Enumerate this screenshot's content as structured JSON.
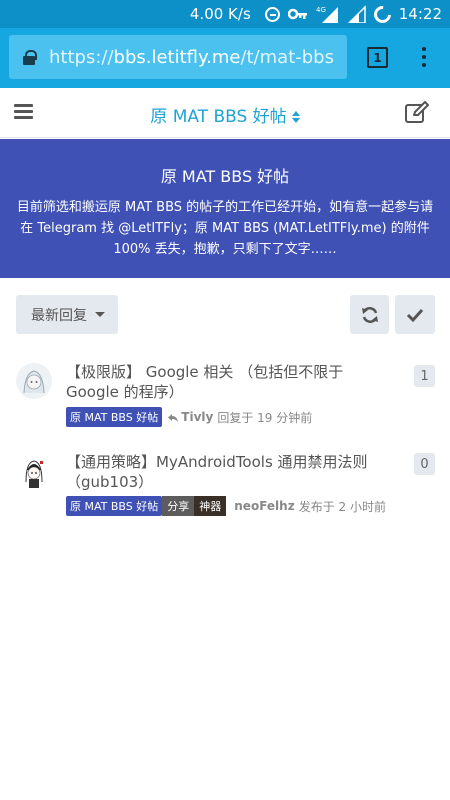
{
  "status_bar": {
    "net_speed": "4.00 K/s",
    "network_type": "4G",
    "time": "14:22",
    "icons": [
      "data-saver-icon",
      "vpn-key-icon",
      "signal-icon",
      "signal-icon",
      "sync-icon"
    ]
  },
  "browser": {
    "url_proto": "https://",
    "url_host": "bbs.letitfly.me",
    "url_path": "/t/mat-bbs",
    "tab_count": "1"
  },
  "header": {
    "title": "原 MAT BBS 好帖"
  },
  "banner": {
    "title": "原 MAT BBS 好帖",
    "description": "目前筛选和搬运原 MAT BBS 的帖子的工作已经开始，如有意一起参与请在 Telegram 找 @LetITFly；原 MAT BBS (MAT.LetITFly.me) 的附件 100% 丢失，抱歉，只剩下了文字……"
  },
  "toolbar": {
    "sort_label": "最新回复"
  },
  "topics": [
    {
      "title": "【极限版】 Google 相关 （包括但不限于 Google 的程序）",
      "category": "原 MAT BBS 好帖",
      "user": "Tivly",
      "action": "回复于 19 分钟前",
      "count": "1"
    },
    {
      "title": "【通用策略】MyAndroidTools 通用禁用法则（gub103）",
      "category": "原 MAT BBS 好帖",
      "tags": [
        "分享",
        "神器"
      ],
      "user": "neoFelhz",
      "action": "发布于 2 小时前",
      "count": "0"
    }
  ],
  "colors": {
    "status_bar": "#0d8fc8",
    "browser_bar": "#16a6e0",
    "accent": "#1ea3d4",
    "banner": "#3f51b5",
    "button_bg": "#e4e9ef"
  }
}
